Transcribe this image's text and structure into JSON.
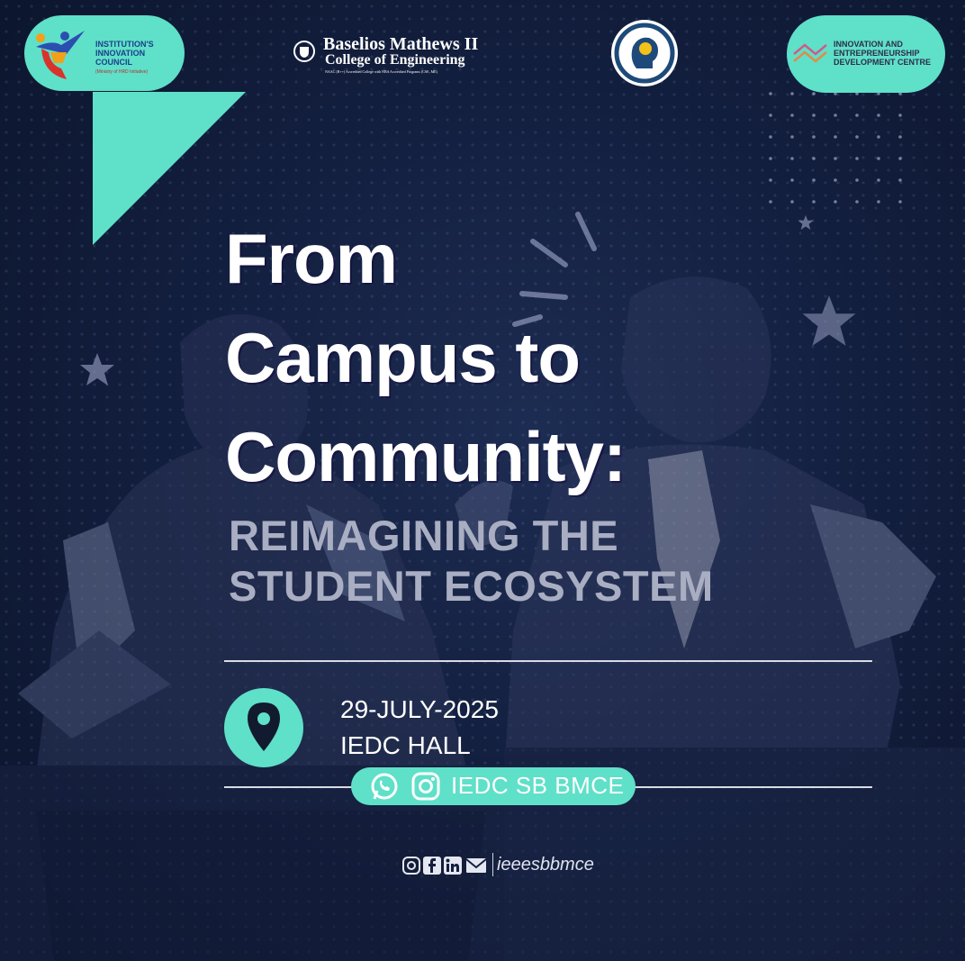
{
  "logos": {
    "iic": {
      "line1": "INSTITUTION'S",
      "line2": "INNOVATION",
      "line3": "COUNCIL",
      "sub": "(Ministry of HRD Initiative)"
    },
    "college": {
      "name_line1": "Baselios Mathews II",
      "name_line2": "College of Engineering",
      "accreditation": "NAAC (B++) Accredited College with NBA Accredited Programs (CSE, ME)"
    },
    "iedc": {
      "line1": "INNOVATION AND",
      "line2": "ENTREPRENEURSHIP",
      "line3": "DEVELOPMENT CENTRE"
    }
  },
  "title": {
    "line1": "From",
    "line2": "Campus to",
    "line3": "Community:"
  },
  "subtitle": {
    "line1": "REIMAGINING THE",
    "line2": "STUDENT ECOSYSTEM"
  },
  "event": {
    "date": "29-JULY-2025",
    "venue": "IEDC HALL"
  },
  "contact": {
    "label": "IEDC SB BMCE",
    "icons": [
      "whatsapp-icon",
      "instagram-icon"
    ]
  },
  "footer": {
    "handle": "ieeesbbmce",
    "icons": [
      "instagram-icon",
      "facebook-icon",
      "linkedin-icon",
      "mail-icon"
    ]
  },
  "colors": {
    "accent": "#5fe0c8",
    "background": "#131f3f",
    "text": "#ffffff",
    "subtitle": "#a9aec2"
  }
}
